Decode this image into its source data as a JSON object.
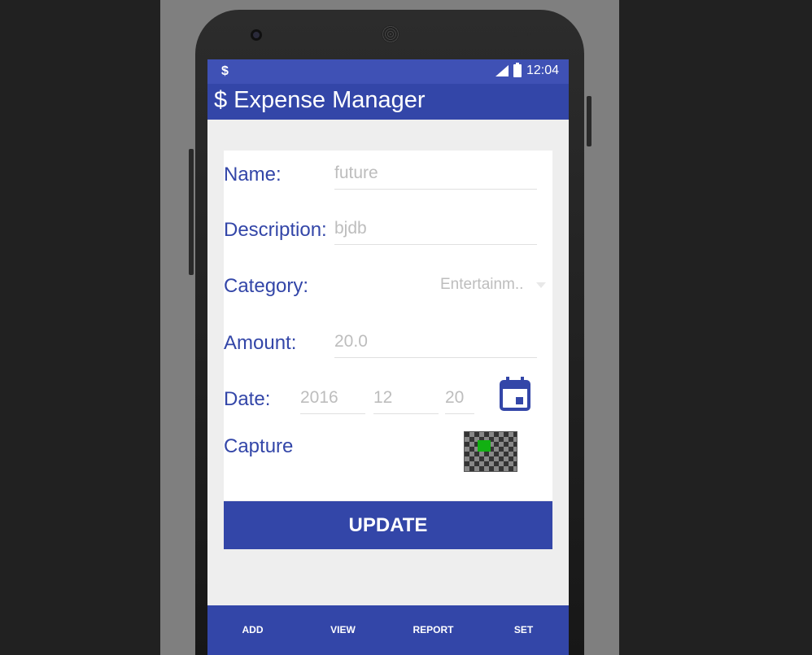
{
  "status_bar": {
    "app_icon": "$",
    "time": "12:04",
    "icons": [
      "signal-icon",
      "battery-icon"
    ]
  },
  "app_bar": {
    "title": "$ Expense Manager"
  },
  "form": {
    "name": {
      "label": "Name:",
      "value": "future"
    },
    "description": {
      "label": "Description:",
      "value": "bjdb"
    },
    "category": {
      "label": "Category:",
      "value": "Entertainm.."
    },
    "amount": {
      "label": "Amount:",
      "value": "20.0"
    },
    "date": {
      "label": "Date:",
      "year": "2016",
      "month": "12",
      "day": "20"
    },
    "capture": {
      "label": "Capture"
    }
  },
  "update_button": "UPDATE",
  "bottom_nav": [
    {
      "label": "ADD"
    },
    {
      "label": "VIEW"
    },
    {
      "label": "REPORT"
    },
    {
      "label": "SET"
    }
  ],
  "colors": {
    "primary": "#3f51b5",
    "primary_dark": "#3346a8",
    "background": "#eeeeee",
    "hint_text": "#bdbdbd"
  }
}
